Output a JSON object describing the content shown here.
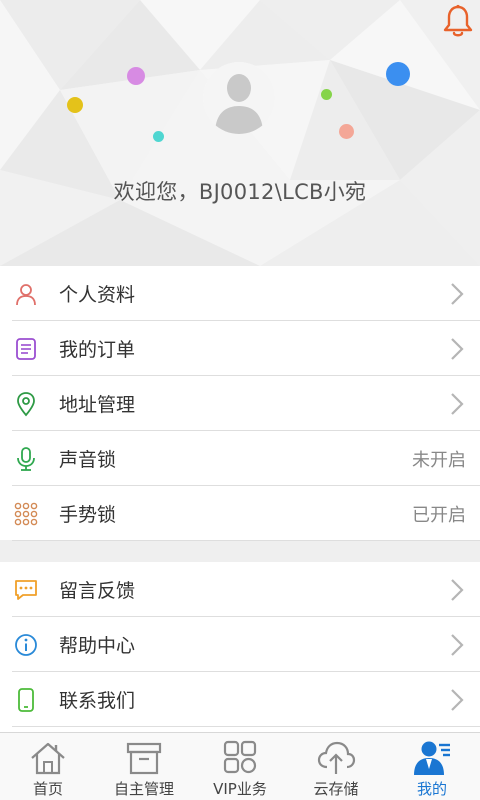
{
  "header": {
    "welcome_text": "欢迎您，BJ0012\\LCB小宛",
    "notification_icon": "bell-icon",
    "bell_color": "#e8622b"
  },
  "menu_group_1": [
    {
      "label": "个人资料",
      "icon": "person-icon",
      "color": "#e0706a",
      "trailing": "chevron"
    },
    {
      "label": "我的订单",
      "icon": "order-list-icon",
      "color": "#9b4fd1",
      "trailing": "chevron"
    },
    {
      "label": "地址管理",
      "icon": "location-pin-icon",
      "color": "#2e9a45",
      "trailing": "chevron"
    },
    {
      "label": "声音锁",
      "icon": "microphone-icon",
      "color": "#2fa84f",
      "status": "未开启"
    },
    {
      "label": "手势锁",
      "icon": "gesture-grid-icon",
      "color": "#d38a55",
      "status": "已开启"
    }
  ],
  "menu_group_2": [
    {
      "label": "留言反馈",
      "icon": "message-icon",
      "color": "#f0a02a",
      "trailing": "chevron"
    },
    {
      "label": "帮助中心",
      "icon": "info-icon",
      "color": "#2a8ad8",
      "trailing": "chevron"
    },
    {
      "label": "联系我们",
      "icon": "phone-icon",
      "color": "#4cbb3a",
      "trailing": "chevron"
    }
  ],
  "bottom_nav": [
    {
      "label": "首页",
      "icon": "home-icon",
      "active": false
    },
    {
      "label": "自主管理",
      "icon": "archive-box-icon",
      "active": false
    },
    {
      "label": "VIP业务",
      "icon": "grid-apps-icon",
      "active": false
    },
    {
      "label": "云存储",
      "icon": "cloud-upload-icon",
      "active": false
    },
    {
      "label": "我的",
      "icon": "user-profile-icon",
      "active": true
    }
  ],
  "colors": {
    "active_tab": "#1a76d2",
    "inactive_icon": "#8a8a8a"
  }
}
